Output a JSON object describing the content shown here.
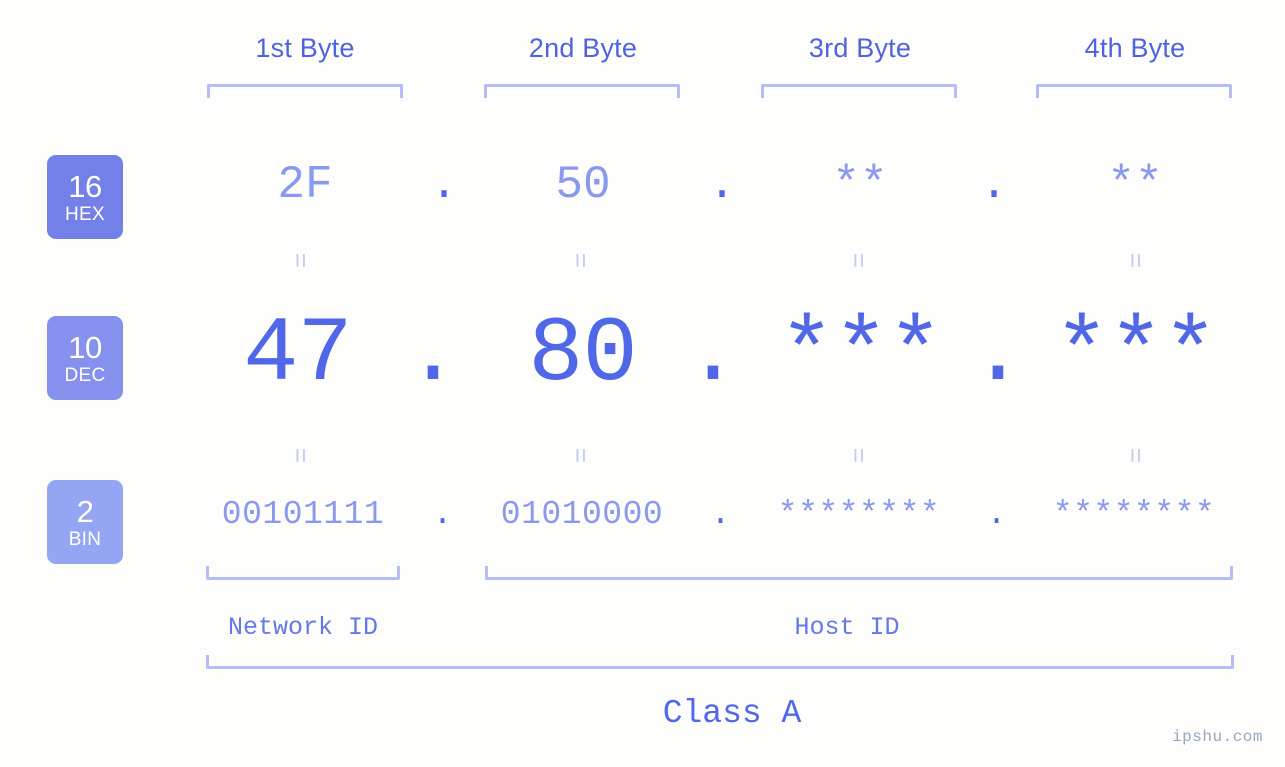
{
  "watermark": "ipshu.com",
  "byte_headers": [
    {
      "label": "1st Byte"
    },
    {
      "label": "2nd Byte"
    },
    {
      "label": "3rd Byte"
    },
    {
      "label": "4th Byte"
    }
  ],
  "bases": [
    {
      "num": "16",
      "abbr": "HEX"
    },
    {
      "num": "10",
      "abbr": "DEC"
    },
    {
      "num": "2",
      "abbr": "BIN"
    }
  ],
  "rows": {
    "hex": {
      "values": [
        "2F",
        "50",
        "**",
        "**"
      ],
      "separator": "."
    },
    "dec": {
      "values": [
        "47",
        "80",
        "***",
        "***"
      ],
      "separator": "."
    },
    "bin": {
      "values": [
        "00101111",
        "01010000",
        "********",
        "********"
      ],
      "separator": "."
    }
  },
  "equal_marks": {
    "glyph": "="
  },
  "sections": [
    {
      "label": "Network ID"
    },
    {
      "label": "Host ID"
    }
  ],
  "class": {
    "label": "Class A"
  },
  "colors": {
    "background": "#fdfefb",
    "accent_dark": "#5068e8",
    "accent_mid": "#8b98ef",
    "accent_light": "#b4bdf6",
    "badge_hex": "#7280e8",
    "badge_dec": "#8591ec",
    "badge_bin": "#93a5f3",
    "header_text": "#4f63e0",
    "watermark": "#9aa6c4"
  }
}
